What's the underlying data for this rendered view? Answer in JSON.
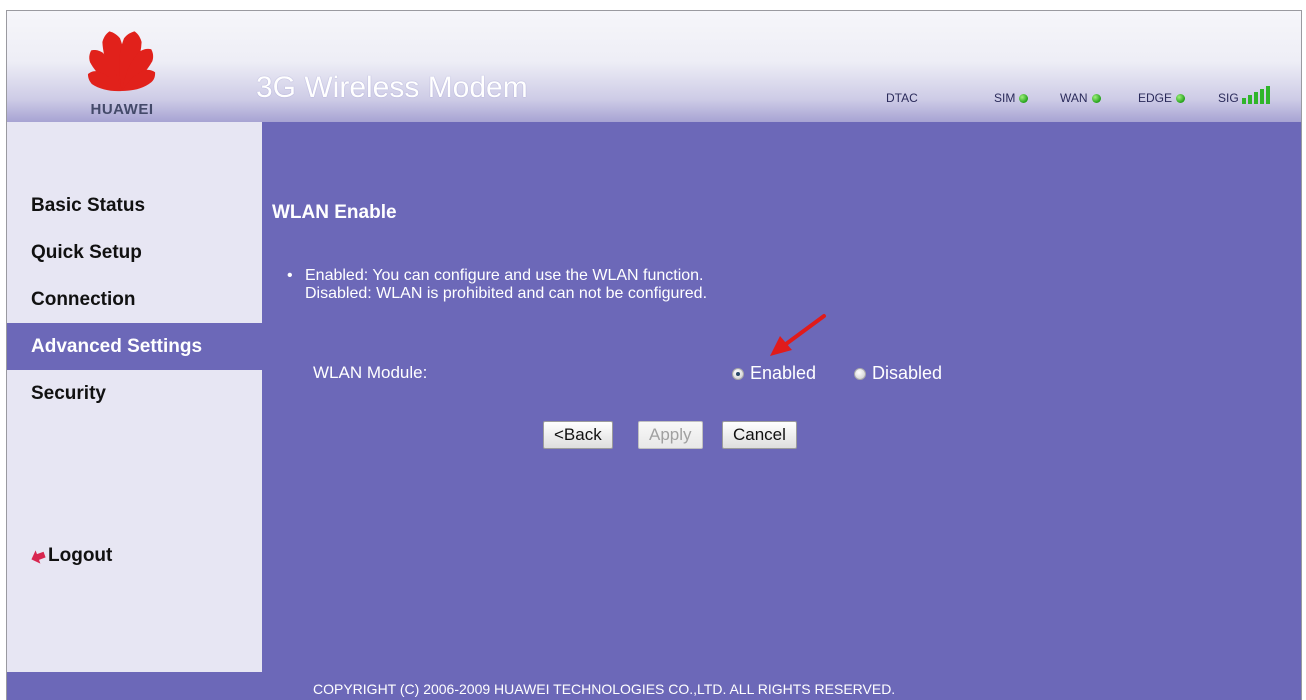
{
  "header": {
    "brand": "HUAWEI",
    "title": "3G Wireless Modem",
    "status": {
      "operator": "DTAC",
      "sim_label": "SIM",
      "wan_label": "WAN",
      "network_label": "EDGE",
      "signal_label": "SIG",
      "signal_bars": 5,
      "led_color": "#23a11a"
    }
  },
  "sidebar": {
    "items": [
      {
        "label": "Basic Status"
      },
      {
        "label": "Quick Setup"
      },
      {
        "label": "Connection"
      },
      {
        "label": "Advanced Settings"
      },
      {
        "label": "Security"
      }
    ],
    "active": "Advanced Settings",
    "logout": "Logout"
  },
  "main": {
    "section_title": "WLAN Enable",
    "description": [
      "Enabled: You can configure and use the WLAN function.",
      "Disabled: WLAN is prohibited and can not be configured."
    ],
    "wlan_module": {
      "label": "WLAN Module:",
      "options": [
        "Enabled",
        "Disabled"
      ],
      "selected": "Enabled"
    },
    "buttons": {
      "back": "<Back",
      "apply": "Apply",
      "cancel": "Cancel"
    }
  },
  "footer": {
    "copyright": "COPYRIGHT (C) 2006-2009 HUAWEI TECHNOLOGIES CO.,LTD. ALL RIGHTS RESERVED."
  },
  "colors": {
    "accent": "#6c68b8",
    "sidebar_bg": "#e7e6f3",
    "brand_red": "#e1211b",
    "arrow_red": "#e01b1b"
  }
}
